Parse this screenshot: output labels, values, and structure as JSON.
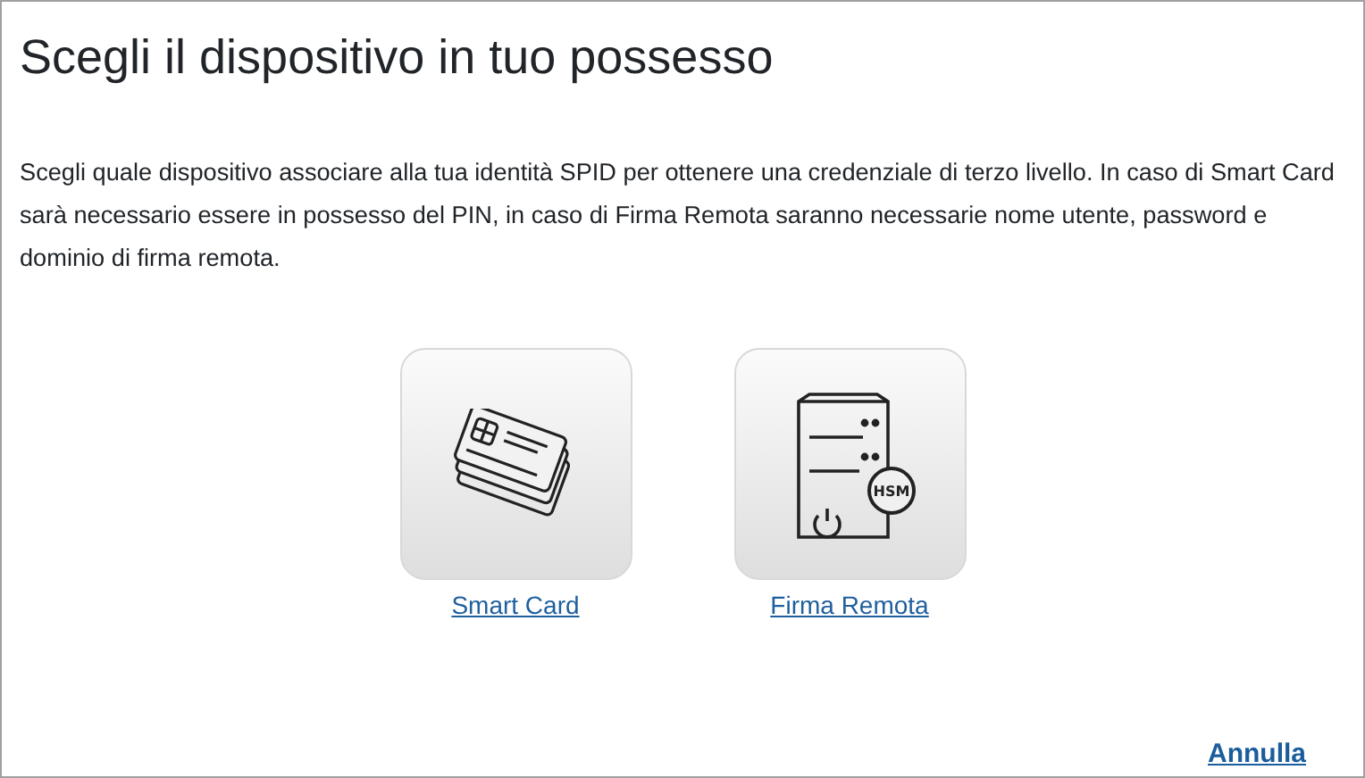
{
  "title": "Scegli il dispositivo in tuo possesso",
  "description": "Scegli quale dispositivo associare alla tua identità SPID per ottenere una credenziale di terzo livello. In caso di Smart Card sarà necessario essere in possesso del PIN, in caso di Firma Remota saranno necessarie nome utente, password e dominio di firma remota.",
  "devices": [
    {
      "kind": "smartcard",
      "label": "Smart Card"
    },
    {
      "kind": "hsm",
      "label": "Firma Remota",
      "badge": "HSM"
    }
  ],
  "cancel": "Annulla"
}
